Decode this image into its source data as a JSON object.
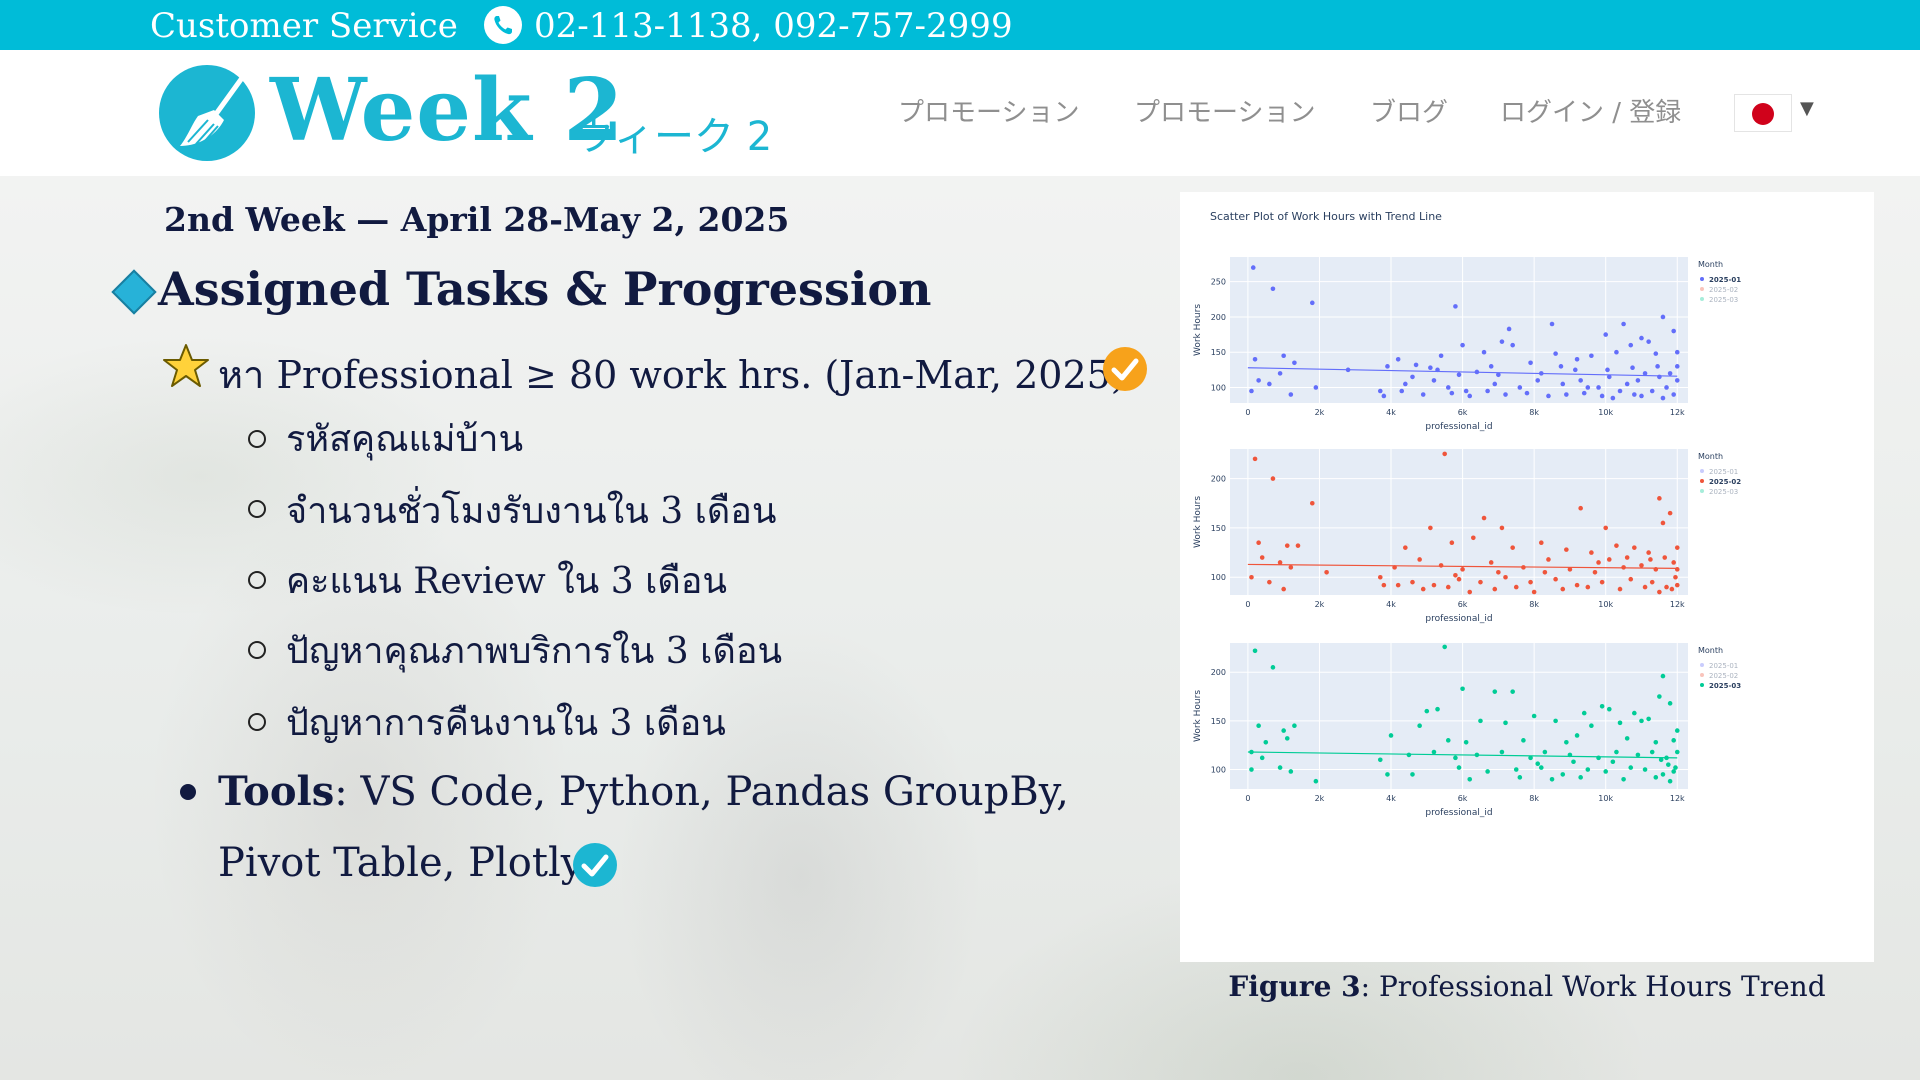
{
  "topbar": {
    "customer_service": "Customer Service",
    "phones": "02-113-1138, 092-757-2999",
    "phone_icon": "phone-icon",
    "bg_color": "#00bcd8"
  },
  "header": {
    "logo_title": "Week 2",
    "logo_subtitle": "ウィーク 2",
    "logo_icon": "broom-icon",
    "brand_color": "#1cb6d2",
    "nav": [
      {
        "label": "プロモーション"
      },
      {
        "label": "プロモーション"
      },
      {
        "label": "ブログ"
      },
      {
        "label": "ログイン / 登録"
      }
    ],
    "language_flag": "japan-flag-icon"
  },
  "content": {
    "week_line": "2nd Week — April 28-May 2, 2025",
    "section_title": "Assigned Tasks & Progression",
    "task_line": "หา Professional ≥ 80 work hrs. (Jan-Mar, 2025)",
    "sub_items": [
      {
        "text": "รหัสคุณแม่บ้าน"
      },
      {
        "text": "จำนวนชั่วโมงรับงานใน 3 เดือน"
      },
      {
        "text": "คะแนน Review ใน 3 เดือน"
      },
      {
        "text": "ปัญหาคุณภาพบริการใน 3 เดือน"
      },
      {
        "text": "ปัญหาการคืนงานใน 3 เดือน"
      }
    ],
    "tools_label": "Tools",
    "tools_rest": ": VS Code, Python, Pandas GroupBy,",
    "tools_line2": "Pivot Table, Plotly"
  },
  "figure": {
    "caption_bold": "Figure 3",
    "caption_rest": ": Professional Work Hours Trend"
  },
  "chart_data": [
    {
      "type": "scatter",
      "title": "Scatter Plot of Work Hours with Trend Line",
      "xlabel": "professional_id",
      "ylabel": "Work Hours",
      "x_ticks": [
        "0",
        "2k",
        "4k",
        "6k",
        "8k",
        "10k",
        "12k"
      ],
      "y_ticks": [
        "100",
        "150",
        "200",
        "250"
      ],
      "xlim": [
        -500,
        12300
      ],
      "ylim": [
        78,
        285
      ],
      "legend_title": "Month",
      "legend": [
        "2025-01",
        "2025-02",
        "2025-03"
      ],
      "active": "2025-01",
      "color": "#636efa",
      "trend": [
        [
          0,
          128
        ],
        [
          12000,
          116
        ]
      ],
      "points": [
        [
          150,
          270
        ],
        [
          700,
          240
        ],
        [
          1800,
          220
        ],
        [
          5800,
          215
        ],
        [
          11600,
          200
        ],
        [
          10500,
          190
        ],
        [
          8500,
          190
        ],
        [
          7300,
          183
        ],
        [
          11900,
          180
        ],
        [
          10000,
          175
        ],
        [
          7100,
          165
        ],
        [
          6000,
          160
        ],
        [
          7400,
          160
        ],
        [
          11200,
          165
        ],
        [
          11000,
          170
        ],
        [
          10700,
          160
        ],
        [
          200,
          140
        ],
        [
          1000,
          145
        ],
        [
          1300,
          135
        ],
        [
          4200,
          140
        ],
        [
          5400,
          145
        ],
        [
          6600,
          150
        ],
        [
          8600,
          148
        ],
        [
          9600,
          145
        ],
        [
          10300,
          150
        ],
        [
          11400,
          148
        ],
        [
          12000,
          150
        ],
        [
          9200,
          140
        ],
        [
          7900,
          135
        ],
        [
          6800,
          130
        ],
        [
          5100,
          128
        ],
        [
          4700,
          132
        ],
        [
          3900,
          130
        ],
        [
          2800,
          125
        ],
        [
          900,
          120
        ],
        [
          300,
          110
        ],
        [
          600,
          105
        ],
        [
          1900,
          100
        ],
        [
          3700,
          95
        ],
        [
          4400,
          105
        ],
        [
          5200,
          110
        ],
        [
          5600,
          100
        ],
        [
          6100,
          95
        ],
        [
          6900,
          105
        ],
        [
          7600,
          100
        ],
        [
          8100,
          110
        ],
        [
          8800,
          105
        ],
        [
          9300,
          110
        ],
        [
          9800,
          100
        ],
        [
          10100,
          115
        ],
        [
          10600,
          105
        ],
        [
          10900,
          110
        ],
        [
          11100,
          120
        ],
        [
          11500,
          115
        ],
        [
          11800,
          120
        ],
        [
          12000,
          110
        ],
        [
          11700,
          100
        ],
        [
          11300,
          95
        ],
        [
          10800,
          90
        ],
        [
          10400,
          95
        ],
        [
          9900,
          88
        ],
        [
          9400,
          92
        ],
        [
          8900,
          90
        ],
        [
          8400,
          88
        ],
        [
          7800,
          92
        ],
        [
          7200,
          90
        ],
        [
          6700,
          95
        ],
        [
          6200,
          88
        ],
        [
          5700,
          92
        ],
        [
          4900,
          90
        ],
        [
          4300,
          95
        ],
        [
          3800,
          88
        ],
        [
          1200,
          90
        ],
        [
          100,
          95
        ],
        [
          11900,
          90
        ],
        [
          11600,
          85
        ],
        [
          11000,
          88
        ],
        [
          10200,
          85
        ],
        [
          9500,
          100
        ],
        [
          8200,
          120
        ],
        [
          7000,
          118
        ],
        [
          6400,
          122
        ],
        [
          5900,
          118
        ],
        [
          5300,
          125
        ],
        [
          4600,
          115
        ],
        [
          12000,
          130
        ],
        [
          11450,
          130
        ],
        [
          10750,
          128
        ],
        [
          10050,
          125
        ],
        [
          9150,
          125
        ],
        [
          8750,
          130
        ]
      ]
    },
    {
      "type": "scatter",
      "xlabel": "professional_id",
      "ylabel": "Work Hours",
      "x_ticks": [
        "0",
        "2k",
        "4k",
        "6k",
        "8k",
        "10k",
        "12k"
      ],
      "y_ticks": [
        "100",
        "150",
        "200"
      ],
      "xlim": [
        -500,
        12300
      ],
      "ylim": [
        82,
        230
      ],
      "legend_title": "Month",
      "legend": [
        "2025-01",
        "2025-02",
        "2025-03"
      ],
      "active": "2025-02",
      "color": "#ef553b",
      "trend": [
        [
          0,
          113
        ],
        [
          12000,
          109
        ]
      ],
      "points": [
        [
          200,
          220
        ],
        [
          700,
          200
        ],
        [
          1800,
          175
        ],
        [
          5500,
          225
        ],
        [
          11500,
          180
        ],
        [
          11800,
          165
        ],
        [
          9300,
          170
        ],
        [
          6600,
          160
        ],
        [
          7100,
          150
        ],
        [
          10000,
          150
        ],
        [
          11600,
          155
        ],
        [
          5100,
          150
        ],
        [
          300,
          135
        ],
        [
          1100,
          132
        ],
        [
          1400,
          132
        ],
        [
          4400,
          130
        ],
        [
          5700,
          135
        ],
        [
          6300,
          140
        ],
        [
          7400,
          130
        ],
        [
          8200,
          135
        ],
        [
          8900,
          128
        ],
        [
          9600,
          125
        ],
        [
          10300,
          132
        ],
        [
          10800,
          130
        ],
        [
          11200,
          125
        ],
        [
          12000,
          130
        ],
        [
          400,
          120
        ],
        [
          900,
          115
        ],
        [
          2200,
          105
        ],
        [
          3700,
          100
        ],
        [
          4100,
          110
        ],
        [
          4800,
          118
        ],
        [
          5400,
          112
        ],
        [
          6000,
          108
        ],
        [
          6800,
          115
        ],
        [
          7700,
          110
        ],
        [
          8400,
          118
        ],
        [
          9000,
          108
        ],
        [
          9800,
          115
        ],
        [
          10500,
          110
        ],
        [
          11000,
          112
        ],
        [
          11400,
          108
        ],
        [
          11900,
          115
        ],
        [
          100,
          100
        ],
        [
          600,
          95
        ],
        [
          1200,
          110
        ],
        [
          3800,
          92
        ],
        [
          4600,
          95
        ],
        [
          5200,
          92
        ],
        [
          5900,
          98
        ],
        [
          6500,
          95
        ],
        [
          7200,
          100
        ],
        [
          7900,
          95
        ],
        [
          8600,
          98
        ],
        [
          9200,
          92
        ],
        [
          9900,
          95
        ],
        [
          10700,
          98
        ],
        [
          11300,
          95
        ],
        [
          11700,
          90
        ],
        [
          12000,
          92
        ],
        [
          11850,
          88
        ],
        [
          11500,
          85
        ],
        [
          11100,
          90
        ],
        [
          10400,
          88
        ],
        [
          9500,
          90
        ],
        [
          8800,
          88
        ],
        [
          8000,
          85
        ],
        [
          7500,
          90
        ],
        [
          6900,
          88
        ],
        [
          6200,
          85
        ],
        [
          5600,
          90
        ],
        [
          4900,
          88
        ],
        [
          4200,
          92
        ],
        [
          1000,
          88
        ],
        [
          10100,
          118
        ],
        [
          10600,
          120
        ],
        [
          11250,
          118
        ],
        [
          11650,
          120
        ],
        [
          9700,
          105
        ],
        [
          8300,
          105
        ],
        [
          7000,
          105
        ],
        [
          5800,
          102
        ],
        [
          12000,
          108
        ],
        [
          11950,
          100
        ]
      ]
    },
    {
      "type": "scatter",
      "xlabel": "professional_id",
      "ylabel": "Work Hours",
      "x_ticks": [
        "0",
        "2k",
        "4k",
        "6k",
        "8k",
        "10k",
        "12k"
      ],
      "y_ticks": [
        "100",
        "150",
        "200"
      ],
      "xlim": [
        -500,
        12300
      ],
      "ylim": [
        80,
        230
      ],
      "legend_title": "Month",
      "legend": [
        "2025-01",
        "2025-02",
        "2025-03"
      ],
      "active": "2025-03",
      "color": "#00cc96",
      "trend": [
        [
          0,
          118
        ],
        [
          12000,
          112
        ]
      ],
      "points": [
        [
          200,
          222
        ],
        [
          700,
          205
        ],
        [
          5500,
          226
        ],
        [
          11600,
          196
        ],
        [
          6000,
          183
        ],
        [
          6900,
          180
        ],
        [
          7400,
          180
        ],
        [
          11500,
          175
        ],
        [
          11800,
          168
        ],
        [
          9900,
          165
        ],
        [
          10100,
          162
        ],
        [
          5000,
          160
        ],
        [
          5300,
          162
        ],
        [
          8000,
          155
        ],
        [
          9400,
          158
        ],
        [
          10800,
          158
        ],
        [
          11200,
          152
        ],
        [
          300,
          145
        ],
        [
          1000,
          140
        ],
        [
          1300,
          145
        ],
        [
          4800,
          145
        ],
        [
          6500,
          150
        ],
        [
          7200,
          148
        ],
        [
          8600,
          150
        ],
        [
          9600,
          145
        ],
        [
          10400,
          148
        ],
        [
          11000,
          150
        ],
        [
          12000,
          140
        ],
        [
          500,
          128
        ],
        [
          1100,
          132
        ],
        [
          4000,
          135
        ],
        [
          5600,
          130
        ],
        [
          6100,
          128
        ],
        [
          7700,
          130
        ],
        [
          8900,
          128
        ],
        [
          9200,
          135
        ],
        [
          10600,
          132
        ],
        [
          11400,
          128
        ],
        [
          11900,
          130
        ],
        [
          100,
          118
        ],
        [
          400,
          112
        ],
        [
          900,
          102
        ],
        [
          3700,
          110
        ],
        [
          4500,
          115
        ],
        [
          5200,
          118
        ],
        [
          5800,
          112
        ],
        [
          6400,
          115
        ],
        [
          7100,
          118
        ],
        [
          7900,
          112
        ],
        [
          8300,
          118
        ],
        [
          9000,
          115
        ],
        [
          9800,
          112
        ],
        [
          10300,
          118
        ],
        [
          10900,
          115
        ],
        [
          11300,
          118
        ],
        [
          11700,
          112
        ],
        [
          12000,
          118
        ],
        [
          100,
          100
        ],
        [
          1200,
          98
        ],
        [
          3900,
          95
        ],
        [
          4600,
          95
        ],
        [
          5900,
          102
        ],
        [
          6700,
          98
        ],
        [
          7500,
          100
        ],
        [
          8200,
          102
        ],
        [
          8800,
          95
        ],
        [
          9500,
          100
        ],
        [
          10000,
          98
        ],
        [
          10700,
          102
        ],
        [
          11100,
          100
        ],
        [
          11600,
          95
        ],
        [
          11900,
          98
        ],
        [
          11800,
          88
        ],
        [
          11400,
          92
        ],
        [
          10500,
          90
        ],
        [
          9300,
          92
        ],
        [
          8500,
          90
        ],
        [
          7600,
          92
        ],
        [
          6200,
          90
        ],
        [
          1900,
          88
        ],
        [
          11950,
          102
        ],
        [
          11750,
          105
        ],
        [
          11550,
          110
        ],
        [
          10200,
          108
        ],
        [
          9100,
          108
        ],
        [
          8100,
          106
        ]
      ]
    }
  ]
}
